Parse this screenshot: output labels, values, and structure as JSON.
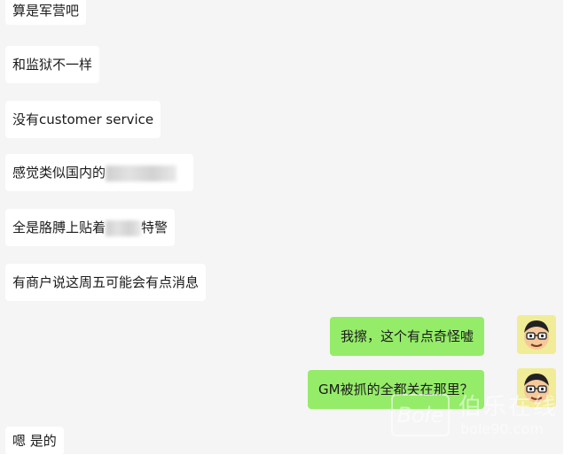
{
  "messages": [
    {
      "side": "left",
      "text": "算是军营吧"
    },
    {
      "side": "left",
      "text": "和监狱不一样"
    },
    {
      "side": "left",
      "text": "没有customer service"
    },
    {
      "side": "left",
      "text": "感觉类似国内的",
      "redacted": true
    },
    {
      "side": "left",
      "text_before": "全是胳膊上贴着",
      "text_after": "特警",
      "redacted": true
    },
    {
      "side": "left",
      "text": "有商户说这周五可能会有点消息"
    },
    {
      "side": "right",
      "text": "我擦，这个有点奇怪嘘"
    },
    {
      "side": "right",
      "text": "GM被抓的全都关在那里？"
    },
    {
      "side": "left",
      "text": "嗯 是的"
    }
  ],
  "watermark": {
    "logo": "Bole",
    "name": "伯乐在线",
    "url": "bole90.com"
  },
  "colors": {
    "chat_bg": "#f5f5f5",
    "left_bubble": "#ffffff",
    "right_bubble": "#95ec69"
  }
}
